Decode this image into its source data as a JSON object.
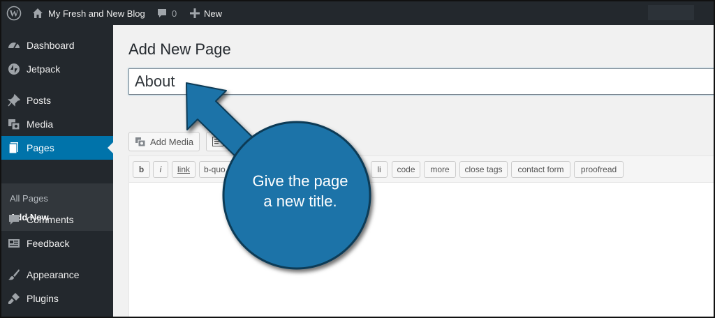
{
  "adminbar": {
    "site_name": "My Fresh and New Blog",
    "comments_count": "0",
    "new_label": "New"
  },
  "sidebar": {
    "items": [
      {
        "label": "Dashboard",
        "icon": "dashboard-icon"
      },
      {
        "label": "Jetpack",
        "icon": "jetpack-icon"
      },
      {
        "label": "Posts",
        "icon": "pin-icon"
      },
      {
        "label": "Media",
        "icon": "media-icon"
      },
      {
        "label": "Pages",
        "icon": "pages-icon"
      },
      {
        "label": "Comments",
        "icon": "comment-icon"
      },
      {
        "label": "Feedback",
        "icon": "feedback-icon"
      },
      {
        "label": "Appearance",
        "icon": "brush-icon"
      },
      {
        "label": "Plugins",
        "icon": "plugin-icon"
      }
    ],
    "submenu": [
      "All Pages",
      "Add New"
    ]
  },
  "main": {
    "page_title": "Add New Page",
    "title_value": "About",
    "add_media_label": "Add Media"
  },
  "quicktags": [
    "b",
    "i",
    "link",
    "b-quo",
    "li",
    "code",
    "more",
    "close tags",
    "contact form",
    "proofread"
  ],
  "callout": {
    "line1": "Give the page",
    "line2": "a new title."
  },
  "colors": {
    "adminbar_bg": "#23282d",
    "active_menu": "#0073aa",
    "callout_fill": "#1a73a8"
  }
}
